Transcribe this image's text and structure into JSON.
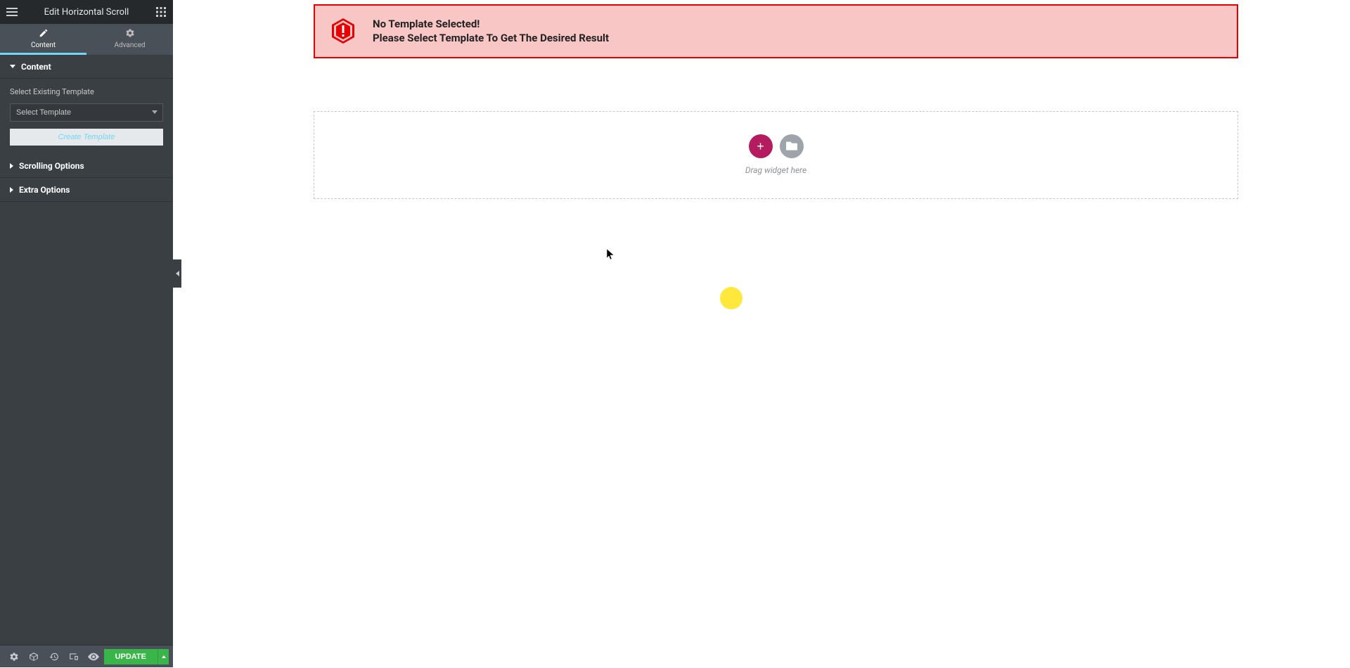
{
  "panel": {
    "title": "Edit Horizontal Scroll",
    "tabs": {
      "content": "Content",
      "advanced": "Advanced"
    },
    "sections": {
      "content_label": "Content",
      "template_field_label": "Select Existing Template",
      "template_placeholder": "Select Template",
      "create_template_btn": "Create Template",
      "scrolling_label": "Scrolling Options",
      "extra_label": "Extra Options"
    },
    "footer": {
      "update": "UPDATE"
    }
  },
  "alert": {
    "title": "No Template Selected!",
    "message": "Please Select Template To Get The Desired Result"
  },
  "dropzone": {
    "hint": "Drag widget here"
  },
  "icons": {
    "burger": "menu-icon",
    "grid": "widgets-grid-icon",
    "pencil": "pencil-icon",
    "gear": "gear-icon",
    "settings": "settings-icon",
    "navigator": "navigator-icon",
    "history": "history-icon",
    "responsive": "responsive-icon",
    "preview": "eye-icon",
    "warning": "warning-hex-icon",
    "folder": "folder-icon"
  }
}
